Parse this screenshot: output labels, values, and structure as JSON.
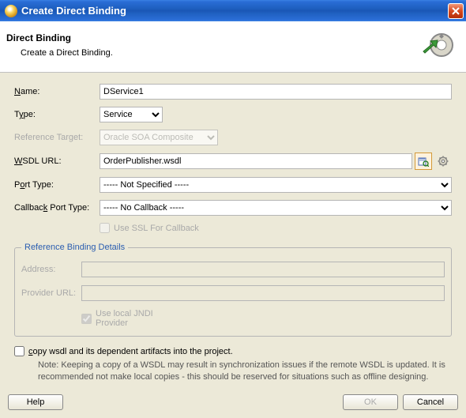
{
  "window": {
    "title": "Create Direct Binding"
  },
  "header": {
    "title": "Direct Binding",
    "subtitle": "Create a Direct Binding."
  },
  "fields": {
    "name": {
      "label_pre": "",
      "label_mn": "N",
      "label_post": "ame:",
      "value": "DService1"
    },
    "type": {
      "label_pre": "T",
      "label_mn": "y",
      "label_post": "pe:",
      "value": "Service"
    },
    "refTarget": {
      "label": "Reference Target:",
      "value": "Oracle SOA Composite"
    },
    "wsdl": {
      "label_pre": "",
      "label_mn": "W",
      "label_post": "SDL URL:",
      "value": "OrderPublisher.wsdl"
    },
    "portType": {
      "label_pre": "P",
      "label_mn": "o",
      "label_post": "rt Type:",
      "value": "----- Not Specified -----"
    },
    "callback": {
      "label_pre": "Callbac",
      "label_mn": "k",
      "label_post": " Port Type:",
      "value": "----- No Callback -----"
    },
    "useSSL": {
      "label_pre": "Use ",
      "label_mn": "S",
      "label_post": "SL For Callback"
    }
  },
  "refDetails": {
    "legend": "Reference Binding Details",
    "address": {
      "label_mn": "A",
      "label_post": "ddress:"
    },
    "provider": {
      "label": "Provider URL:"
    },
    "jndi": {
      "label_pre": "Use local ",
      "label_mn": "J",
      "label_post": "NDI Provider"
    }
  },
  "copy": {
    "label_pre": "",
    "label_mn": "c",
    "label_post": "opy wsdl and its dependent artifacts into the project."
  },
  "note": "Note: Keeping a copy of a WSDL may result in synchronization issues if the remote WSDL is updated. It is recommended not make local copies - this should be reserved for situations such as offline designing.",
  "buttons": {
    "help": "Help",
    "ok": "OK",
    "cancel": "Cancel"
  }
}
